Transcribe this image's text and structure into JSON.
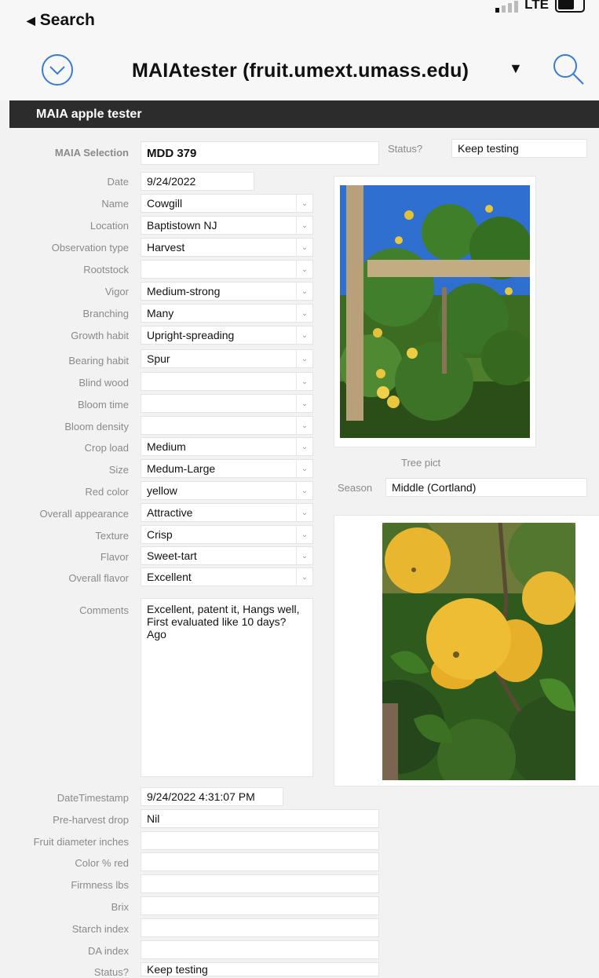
{
  "statusbar": {
    "back_label": "Search",
    "network": "LTE"
  },
  "nav": {
    "title": "MAIAtester (fruit.umext.umass.edu)",
    "caret": "▼"
  },
  "section": {
    "title": "MAIA apple tester"
  },
  "header_fields": {
    "maia_selection_label": "MAIA Selection",
    "maia_selection_value": "MDD 379",
    "status_label": "Status?",
    "status_value": "Keep testing"
  },
  "fields": [
    {
      "label": "Date",
      "value": "9/24/2022"
    },
    {
      "label": "Name",
      "value": "Cowgill"
    },
    {
      "label": "Location",
      "value": "Baptistown NJ"
    },
    {
      "label": "Observation type",
      "value": "Harvest"
    },
    {
      "label": "Rootstock",
      "value": ""
    },
    {
      "label": "Vigor",
      "value": "Medium-strong"
    },
    {
      "label": "Branching",
      "value": "Many"
    },
    {
      "label": "Growth habit",
      "value": "Upright-spreading"
    },
    {
      "label": "Bearing habit",
      "value": "Spur"
    },
    {
      "label": "Blind wood",
      "value": ""
    },
    {
      "label": "Bloom time",
      "value": ""
    },
    {
      "label": "Bloom density",
      "value": ""
    },
    {
      "label": "Crop load",
      "value": "Medium"
    },
    {
      "label": "Size",
      "value": "Medum-Large"
    },
    {
      "label": "Red color",
      "value": "yellow"
    },
    {
      "label": "Overall appearance",
      "value": "Attractive"
    },
    {
      "label": "Texture",
      "value": "Crisp"
    },
    {
      "label": "Flavor",
      "value": "Sweet-tart"
    },
    {
      "label": "Overall flavor",
      "value": "Excellent"
    }
  ],
  "comments": {
    "label": "Comments",
    "value": "Excellent, patent it, Hangs well, First evaluated like 10 days? Ago"
  },
  "tree_pict": {
    "caption": "Tree pict"
  },
  "season": {
    "label": "Season",
    "value": "Middle (Cortland)"
  },
  "lower_fields": [
    {
      "label": "DateTimestamp",
      "value": "9/24/2022 4:31:07 PM"
    },
    {
      "label": "Pre-harvest drop",
      "value": "Nil"
    },
    {
      "label": "Fruit diameter inches",
      "value": ""
    },
    {
      "label": "Color % red",
      "value": ""
    },
    {
      "label": "Firmness lbs",
      "value": ""
    },
    {
      "label": "Brix",
      "value": ""
    },
    {
      "label": "Starch index",
      "value": ""
    },
    {
      "label": "DA index",
      "value": ""
    },
    {
      "label": "Status?",
      "value": "Keep testing"
    }
  ],
  "colors": {
    "accent": "#3a7bd5",
    "header_bg": "#2c2c2c",
    "label": "#8a8a8a"
  }
}
